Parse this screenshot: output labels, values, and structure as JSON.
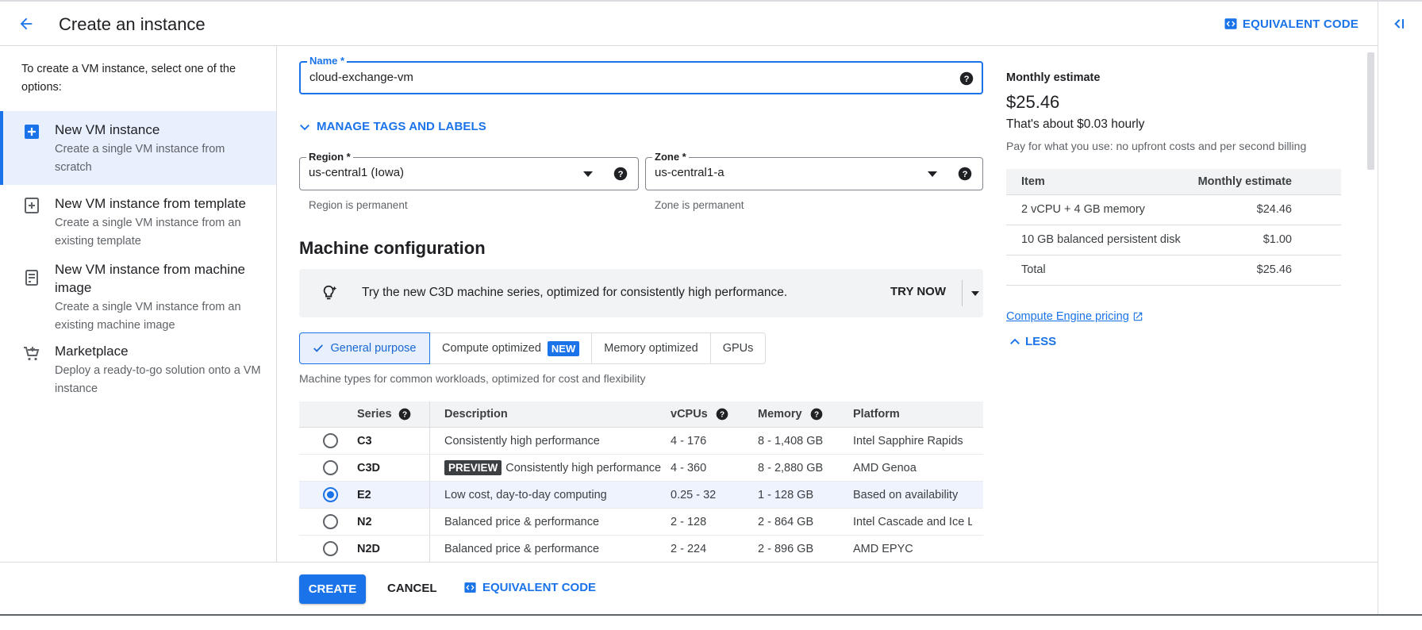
{
  "header": {
    "title": "Create an instance",
    "equivalent_code": "EQUIVALENT CODE"
  },
  "sidebar": {
    "intro": "To create a VM instance, select one of the options:",
    "options": [
      {
        "title": "New VM instance",
        "desc": "Create a single VM instance from scratch",
        "icon": "add-box-icon",
        "selected": true
      },
      {
        "title": "New VM instance from template",
        "desc": "Create a single VM instance from an existing template",
        "icon": "add-outline-box-icon",
        "selected": false
      },
      {
        "title": "New VM instance from machine image",
        "desc": "Create a single VM instance from an existing machine image",
        "icon": "server-image-icon",
        "selected": false
      },
      {
        "title": "Marketplace",
        "desc": "Deploy a ready-to-go solution onto a VM instance",
        "icon": "cart-icon",
        "selected": false
      }
    ]
  },
  "form": {
    "name_label": "Name *",
    "name_value": "cloud-exchange-vm",
    "manage_tags": "MANAGE TAGS AND LABELS",
    "region_label": "Region *",
    "region_value": "us-central1 (Iowa)",
    "region_hint": "Region is permanent",
    "zone_label": "Zone *",
    "zone_value": "us-central1-a",
    "zone_hint": "Zone is permanent"
  },
  "machine": {
    "title": "Machine configuration",
    "banner_text": "Try the new C3D machine series, optimized for consistently high performance.",
    "banner_action": "TRY NOW",
    "tabs": [
      "General purpose",
      "Compute optimized",
      "Memory optimized",
      "GPUs"
    ],
    "new_badge": "NEW",
    "tab_desc": "Machine types for common workloads, optimized for cost and flexibility",
    "columns": {
      "series": "Series",
      "description": "Description",
      "vcpus": "vCPUs",
      "memory": "Memory",
      "platform": "Platform"
    },
    "preview_badge": "PREVIEW",
    "rows": [
      {
        "series": "C3",
        "desc": "Consistently high performance",
        "vcpus": "4 - 176",
        "memory": "8 - 1,408 GB",
        "platform": "Intel Sapphire Rapids",
        "selected": false
      },
      {
        "series": "C3D",
        "desc": "Consistently high performance",
        "vcpus": "4 - 360",
        "memory": "8 - 2,880 GB",
        "platform": "AMD Genoa",
        "selected": false
      },
      {
        "series": "E2",
        "desc": "Low cost, day-to-day computing",
        "vcpus": "0.25 - 32",
        "memory": "1 - 128 GB",
        "platform": "Based on availability",
        "selected": true
      },
      {
        "series": "N2",
        "desc": "Balanced price & performance",
        "vcpus": "2 - 128",
        "memory": "2 - 864 GB",
        "platform": "Intel Cascade and Ice L",
        "selected": false
      },
      {
        "series": "N2D",
        "desc": "Balanced price & performance",
        "vcpus": "2 - 224",
        "memory": "2 - 896 GB",
        "platform": "AMD EPYC",
        "selected": false
      }
    ]
  },
  "estimate": {
    "label": "Monthly estimate",
    "price": "$25.46",
    "hourly": "That's about $0.03 hourly",
    "note": "Pay for what you use: no upfront costs and per second billing",
    "col_item": "Item",
    "col_estimate": "Monthly estimate",
    "rows": [
      {
        "item": "2 vCPU + 4 GB memory",
        "value": "$24.46"
      },
      {
        "item": "10 GB balanced persistent disk",
        "value": "$1.00"
      },
      {
        "item": "Total",
        "value": "$25.46"
      }
    ],
    "pricing_link": "Compute Engine pricing",
    "less": "LESS"
  },
  "footer": {
    "create": "CREATE",
    "cancel": "CANCEL",
    "equivalent_code": "EQUIVALENT CODE"
  },
  "colors": {
    "accent": "#1a73e8",
    "selected_bg": "#e8f0fe",
    "text": "#202124",
    "muted": "#5f6368"
  }
}
